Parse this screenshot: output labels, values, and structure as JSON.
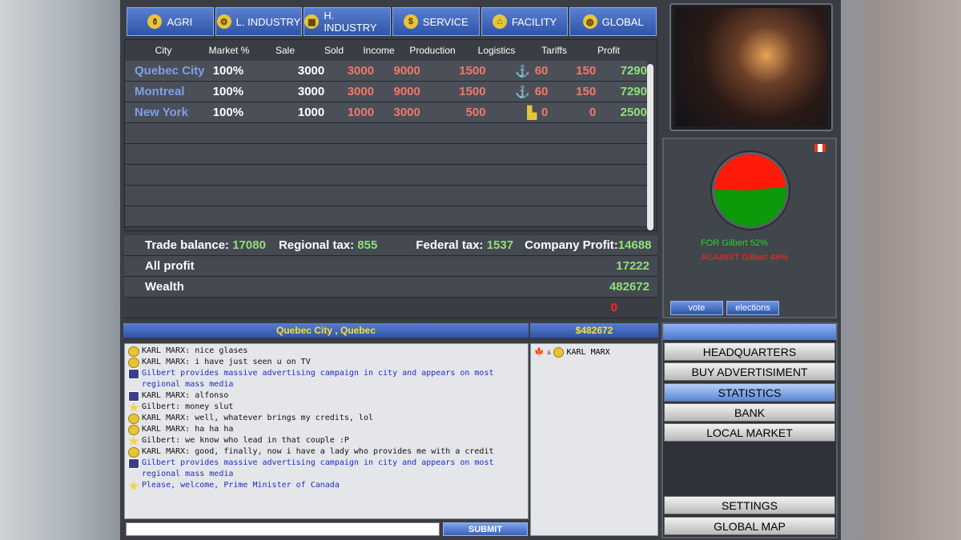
{
  "tabs": [
    {
      "label": "AGRI",
      "icon": "wheat-icon",
      "glyph": "⚱"
    },
    {
      "label": "L. INDUSTRY",
      "icon": "gear-icon",
      "glyph": "⚙"
    },
    {
      "label": "H. INDUSTRY",
      "icon": "factory-icon",
      "glyph": "▦"
    },
    {
      "label": "SERVICE",
      "icon": "dollar-icon",
      "glyph": "$"
    },
    {
      "label": "FACILITY",
      "icon": "building-icon",
      "glyph": "⌂"
    },
    {
      "label": "GLOBAL",
      "icon": "globe-icon",
      "glyph": "◍"
    }
  ],
  "table": {
    "headers": [
      "City",
      "Market %",
      "Sale",
      "Sold",
      "Income",
      "Production",
      "Logistics",
      "Tariffs",
      "Profit"
    ],
    "rows": [
      {
        "city": "Quebec City",
        "market": "100%",
        "sale": "3000",
        "sold": "3000",
        "income": "9000",
        "production": "1500",
        "logistics": "60",
        "tariffs": "150",
        "profit": "7290",
        "logistics_icon": "anchor-icon"
      },
      {
        "city": "Montreal",
        "market": "100%",
        "sale": "3000",
        "sold": "3000",
        "income": "9000",
        "production": "1500",
        "logistics": "60",
        "tariffs": "150",
        "profit": "7290",
        "logistics_icon": "anchor-icon"
      },
      {
        "city": "New York",
        "market": "100%",
        "sale": "1000",
        "sold": "1000",
        "income": "3000",
        "production": "500",
        "logistics": "0",
        "tariffs": "0",
        "profit": "2500",
        "logistics_icon": "warehouse-icon"
      }
    ]
  },
  "summary": {
    "trade_balance_label": "Trade balance:",
    "trade_balance": "17080",
    "regional_tax_label": "Regional tax:",
    "regional_tax": "855",
    "federal_tax_label": "Federal tax:",
    "federal_tax": "1537",
    "company_profit_label": "Company Profit:",
    "company_profit": "14688",
    "all_profit_label": "All profit",
    "all_profit": "17222",
    "wealth_label": "Wealth",
    "wealth": "482672",
    "debt": "0"
  },
  "election": {
    "for_label": "FOR Gilbert 52%",
    "against_label": "AGAINST Gilbert 48%",
    "for_pct": 52,
    "against_pct": 48,
    "vote_label": "vote",
    "elections_label": "elections"
  },
  "location": {
    "city": "Quebec City , Quebec",
    "money": "$482672"
  },
  "chat": {
    "messages": [
      {
        "type": "coin",
        "text": "KARL MARX: nice glases",
        "blue": false
      },
      {
        "type": "coin",
        "text": "KARL MARX: i have just seen u on TV",
        "blue": false
      },
      {
        "type": "sys",
        "text": "Gilbert provides massive advertising campaign in city and appears on most",
        "blue": true
      },
      {
        "type": "none",
        "text": "regional mass media",
        "blue": true
      },
      {
        "type": "sys",
        "text": "KARL MARX: alfonso",
        "blue": false
      },
      {
        "type": "star",
        "text": "Gilbert: money slut",
        "blue": false
      },
      {
        "type": "coin",
        "text": "KARL MARX: well, whatever brings my credits, lol",
        "blue": false
      },
      {
        "type": "coin",
        "text": "KARL MARX: ha ha ha",
        "blue": false
      },
      {
        "type": "star",
        "text": "Gilbert: we know who lead in that couple :P",
        "blue": false
      },
      {
        "type": "coin",
        "text": "KARL MARX: good, finally, now i have a lady who provides me with a credit",
        "blue": false
      },
      {
        "type": "sys",
        "text": "Gilbert provides massive advertising campaign in city and appears on most",
        "blue": true
      },
      {
        "type": "none",
        "text": "regional mass media",
        "blue": true
      },
      {
        "type": "star",
        "text": "Please, welcome, Prime Minister of Canada",
        "blue": true
      }
    ],
    "input_value": "",
    "submit_label": "SUBMIT"
  },
  "users": [
    {
      "name": "KARL MARX"
    }
  ],
  "menu": {
    "headquarters": "HEADQUARTERS",
    "buy_ad": "BUY ADVERTISIMENT",
    "statistics": "STATISTICS",
    "bank": "BANK",
    "local_market": "LOCAL MARKET",
    "settings": "SETTINGS",
    "global_map": "GLOBAL MAP"
  },
  "colors": {
    "tab_blue": "#2f55a8",
    "positive": "#8fe07a",
    "negative": "#f07a6a",
    "city_link": "#7fa0ea"
  }
}
